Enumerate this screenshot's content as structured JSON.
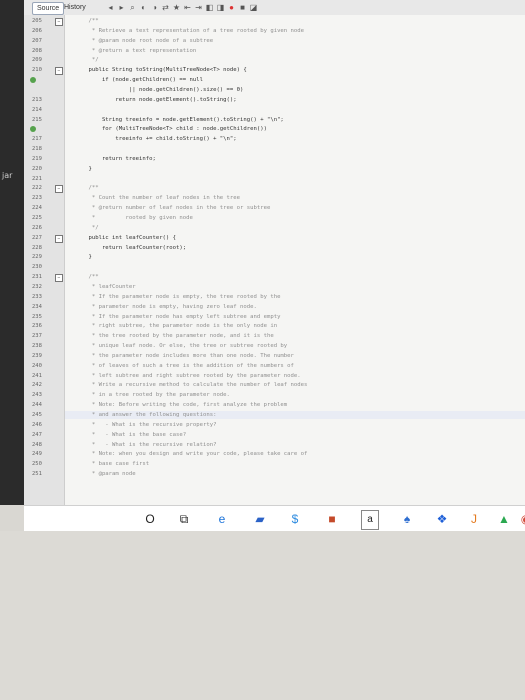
{
  "side_label": "jar",
  "tabs": {
    "source": "Source",
    "history": "History"
  },
  "toolbar_icons": [
    "back-icon",
    "forward-icon",
    "search-icon",
    "prev-icon",
    "next-icon",
    "toggle-icon",
    "bookmark-icon",
    "shift-left-icon",
    "shift-right-icon",
    "comment-icon",
    "uncomment-icon",
    "record-icon",
    "stop-icon",
    "macro-icon"
  ],
  "lines": [
    {
      "n": "205",
      "t": "    /**",
      "c": "comment"
    },
    {
      "n": "206",
      "t": "     * Retrieve a text representation of a tree rooted by given node",
      "c": "comment"
    },
    {
      "n": "207",
      "t": "     * @param node root node of a subtree",
      "c": "comment"
    },
    {
      "n": "208",
      "t": "     * @return a text representation",
      "c": "comment"
    },
    {
      "n": "209",
      "t": "     */",
      "c": "comment"
    },
    {
      "n": "210",
      "t": "    public String toString(MultiTreeNode<T> node) {",
      "c": "code"
    },
    {
      "n": "",
      "t": "        if (node.getChildren() == null",
      "c": "code"
    },
    {
      "n": "",
      "t": "                || node.getChildren().size() == 0)",
      "c": "code"
    },
    {
      "n": "213",
      "t": "            return node.getElement().toString();",
      "c": "code"
    },
    {
      "n": "214",
      "t": "",
      "c": "code"
    },
    {
      "n": "215",
      "t": "        String treeinfo = node.getElement().toString() + \"\\n\";",
      "c": "code"
    },
    {
      "n": "",
      "t": "        for (MultiTreeNode<T> child : node.getChildren())",
      "c": "code"
    },
    {
      "n": "217",
      "t": "            treeinfo += child.toString() + \"\\n\";",
      "c": "code"
    },
    {
      "n": "218",
      "t": "",
      "c": "code"
    },
    {
      "n": "219",
      "t": "        return treeinfo;",
      "c": "code"
    },
    {
      "n": "220",
      "t": "    }",
      "c": "code"
    },
    {
      "n": "221",
      "t": "",
      "c": "code"
    },
    {
      "n": "222",
      "t": "    /**",
      "c": "comment"
    },
    {
      "n": "223",
      "t": "     * Count the number of leaf nodes in the tree",
      "c": "comment"
    },
    {
      "n": "224",
      "t": "     * @return number of leaf nodes in the tree or subtree",
      "c": "comment"
    },
    {
      "n": "225",
      "t": "     *         rooted by given node",
      "c": "comment"
    },
    {
      "n": "226",
      "t": "     */",
      "c": "comment"
    },
    {
      "n": "227",
      "t": "    public int leafCounter() {",
      "c": "code"
    },
    {
      "n": "228",
      "t": "        return leafCounter(root);",
      "c": "code"
    },
    {
      "n": "229",
      "t": "    }",
      "c": "code"
    },
    {
      "n": "230",
      "t": "",
      "c": "code"
    },
    {
      "n": "231",
      "t": "    /**",
      "c": "comment"
    },
    {
      "n": "232",
      "t": "     * leafCounter",
      "c": "comment"
    },
    {
      "n": "233",
      "t": "     * If the parameter node is empty, the tree rooted by the",
      "c": "comment"
    },
    {
      "n": "234",
      "t": "     * parameter node is empty, having zero leaf node.",
      "c": "comment"
    },
    {
      "n": "235",
      "t": "     * If the parameter node has empty left subtree and empty",
      "c": "comment"
    },
    {
      "n": "236",
      "t": "     * right subtree, the parameter node is the only node in",
      "c": "comment"
    },
    {
      "n": "237",
      "t": "     * the tree rooted by the parameter node, and it is the",
      "c": "comment"
    },
    {
      "n": "238",
      "t": "     * unique leaf node. Or else, the tree or subtree rooted by",
      "c": "comment"
    },
    {
      "n": "239",
      "t": "     * the parameter node includes more than one node. The number",
      "c": "comment"
    },
    {
      "n": "240",
      "t": "     * of leaves of such a tree is the addition of the numbers of",
      "c": "comment"
    },
    {
      "n": "241",
      "t": "     * left subtree and right subtree rooted by the parameter node.",
      "c": "comment"
    },
    {
      "n": "242",
      "t": "     * Write a recursive method to calculate the number of leaf nodes",
      "c": "comment"
    },
    {
      "n": "243",
      "t": "     * in a tree rooted by the parameter node.",
      "c": "comment"
    },
    {
      "n": "244",
      "t": "     * Note: Before writing the code, first analyze the problem",
      "c": "comment"
    },
    {
      "n": "245",
      "t": "     * and answer the following questions:",
      "c": "comment"
    },
    {
      "n": "246",
      "t": "     *   - What is the recursive property?",
      "c": "comment"
    },
    {
      "n": "247",
      "t": "     *   - What is the base case?",
      "c": "comment"
    },
    {
      "n": "248",
      "t": "     *   - What is the recursive relation?",
      "c": "comment"
    },
    {
      "n": "249",
      "t": "     * Note: when you design and write your code, please take care of",
      "c": "comment"
    },
    {
      "n": "250",
      "t": "     * base case first",
      "c": "comment"
    },
    {
      "n": "251",
      "t": "     * @param node",
      "c": "comment"
    }
  ],
  "taskbar": {
    "items": [
      {
        "name": "cortana-icon",
        "glyph": "O",
        "color": "#222"
      },
      {
        "name": "task-view-icon",
        "glyph": "⧉",
        "color": "#222"
      },
      {
        "name": "edge-icon",
        "glyph": "e",
        "color": "#1b73d9"
      },
      {
        "name": "photos-icon",
        "glyph": "▰",
        "color": "#2b62c7"
      },
      {
        "name": "store-icon",
        "glyph": "$",
        "color": "#2d8be0"
      },
      {
        "name": "office-icon",
        "glyph": "■",
        "color": "#c44a2a"
      },
      {
        "name": "amazon-icon",
        "glyph": "a",
        "color": "#222"
      },
      {
        "name": "xbox-icon",
        "glyph": "♠",
        "color": "#2d6dd0"
      },
      {
        "name": "dropbox-icon",
        "glyph": "❖",
        "color": "#1f60d8"
      },
      {
        "name": "java-icon",
        "glyph": "J",
        "color": "#e47a1f"
      },
      {
        "name": "drive-icon",
        "glyph": "▲",
        "color": "#2aa84f"
      },
      {
        "name": "chrome-icon",
        "glyph": "◉",
        "color": "#d24c3c"
      }
    ]
  }
}
